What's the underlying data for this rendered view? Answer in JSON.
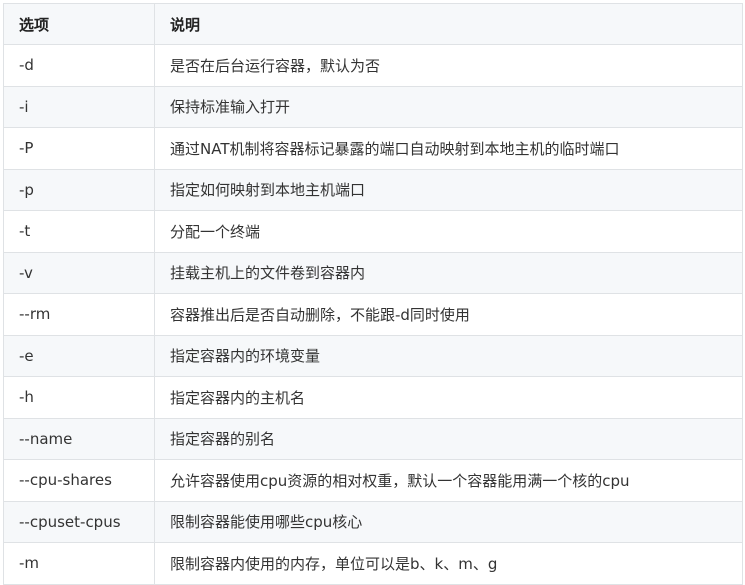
{
  "table": {
    "headers": [
      "选项",
      "说明"
    ],
    "rows": [
      {
        "option": "-d",
        "description": "是否在后台运行容器，默认为否"
      },
      {
        "option": "-i",
        "description": "保持标准输入打开"
      },
      {
        "option": "-P",
        "description": "通过NAT机制将容器标记暴露的端口自动映射到本地主机的临时端口"
      },
      {
        "option": "-p",
        "description": "指定如何映射到本地主机端口"
      },
      {
        "option": "-t",
        "description": "分配一个终端"
      },
      {
        "option": "-v",
        "description": "挂载主机上的文件卷到容器内"
      },
      {
        "option": "--rm",
        "description": "容器推出后是否自动删除，不能跟-d同时使用"
      },
      {
        "option": "-e",
        "description": "指定容器内的环境变量"
      },
      {
        "option": "-h",
        "description": "指定容器内的主机名"
      },
      {
        "option": "--name",
        "description": "指定容器的别名"
      },
      {
        "option": "--cpu-shares",
        "description": "允许容器使用cpu资源的相对权重，默认一个容器能用满一个核的cpu"
      },
      {
        "option": "--cpuset-cpus",
        "description": "限制容器能使用哪些cpu核心"
      },
      {
        "option": "-m",
        "description": "限制容器内使用的内存，单位可以是b、k、m、g"
      }
    ]
  }
}
